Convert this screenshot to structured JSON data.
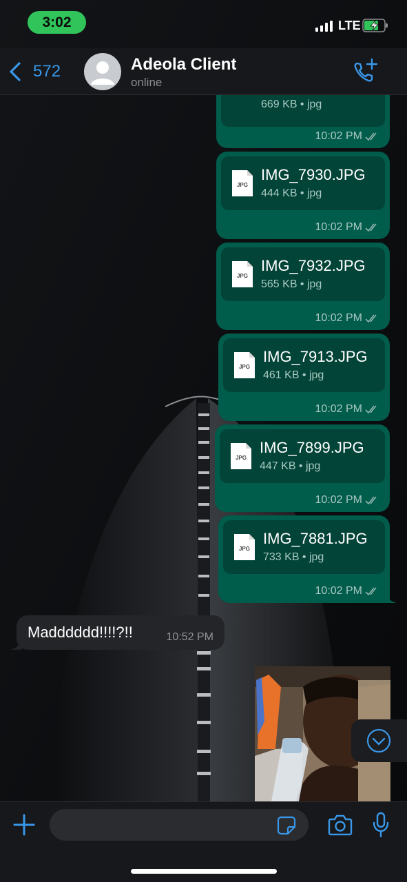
{
  "status_bar": {
    "time": "3:02",
    "network": "LTE"
  },
  "header": {
    "back_count": "572",
    "contact_name": "Adeola Client",
    "contact_status": "online"
  },
  "messages": [
    {
      "file_name": "",
      "file_meta": "669 KB • jpg",
      "time": "10:02 PM",
      "icon_label": ""
    },
    {
      "file_name": "IMG_7930.JPG",
      "file_meta": "444 KB • jpg",
      "time": "10:02 PM",
      "icon_label": "JPG"
    },
    {
      "file_name": "IMG_7932.JPG",
      "file_meta": "565 KB • jpg",
      "time": "10:02 PM",
      "icon_label": "JPG"
    },
    {
      "file_name": "IMG_7913.JPG",
      "file_meta": "461 KB • jpg",
      "time": "10:02 PM",
      "icon_label": "JPG"
    },
    {
      "file_name": "IMG_7899.JPG",
      "file_meta": "447 KB • jpg",
      "time": "10:02 PM",
      "icon_label": "JPG"
    },
    {
      "file_name": "IMG_7881.JPG",
      "file_meta": "733 KB • jpg",
      "time": "10:02 PM",
      "icon_label": "JPG"
    }
  ],
  "incoming": {
    "text": "Madddddd!!!!?!!",
    "time": "10:52 PM"
  },
  "composer": {
    "placeholder": ""
  },
  "colors": {
    "outgoing_bubble": "#005c4b",
    "file_card": "#034438",
    "incoming_bubble": "#232528",
    "accent": "#3a97e8",
    "status_pill": "#30c45a"
  },
  "icons": [
    "back-chevron-icon",
    "add-call-icon",
    "file-icon",
    "double-check-icon",
    "chevron-down-circle-icon",
    "plus-icon",
    "sticker-icon",
    "camera-icon",
    "microphone-icon"
  ]
}
